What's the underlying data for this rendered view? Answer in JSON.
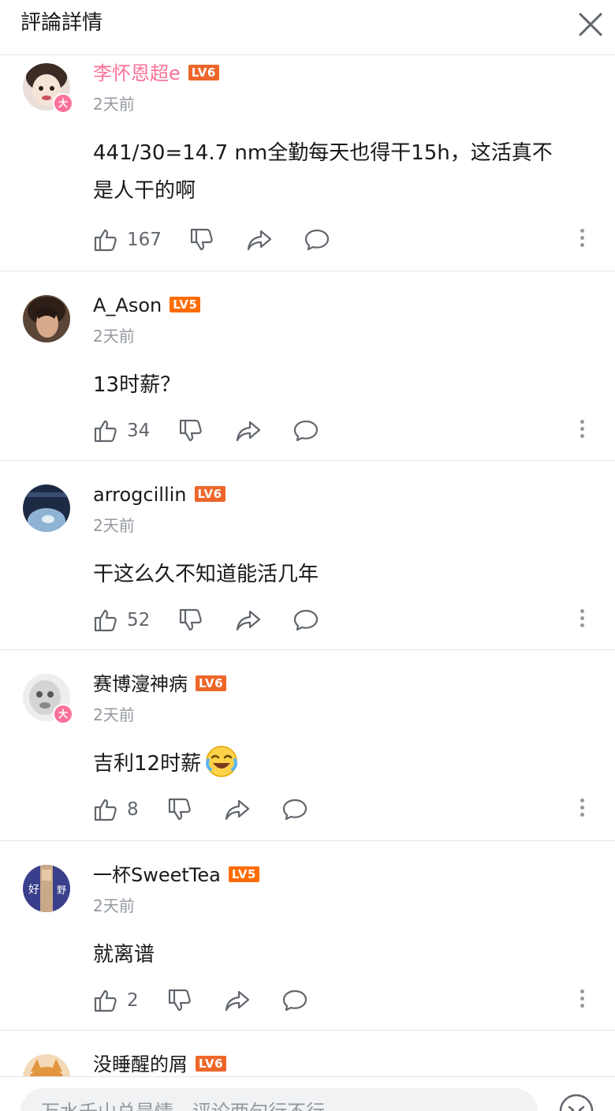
{
  "header": {
    "title": "評論詳情"
  },
  "colors": {
    "vip_name": "#fb7299",
    "level_badge": "#ee672a",
    "muted_text": "#9499a0",
    "divider": "#e3e5e7"
  },
  "icons": {
    "close": "close-icon",
    "like": "thumbs-up-icon",
    "dislike": "thumbs-down-icon",
    "share": "share-icon",
    "reply": "reply-bubble-icon",
    "more": "more-vertical-icon",
    "emoji": "emoji-icon"
  },
  "comments": [
    {
      "user": "李怀恩超e",
      "level": "LV6",
      "vip_badge": "大",
      "time": "2天前",
      "lines": [
        "441/30=14.7 nm全勤每天也得干15h，这活真不",
        "是人干的啊"
      ],
      "likes": "167"
    },
    {
      "user": "A_Ason",
      "level": "LV5",
      "time": "2天前",
      "lines": [
        "13时薪？"
      ],
      "likes": "34"
    },
    {
      "user": "arrogcillin",
      "level": "LV6",
      "time": "2天前",
      "lines": [
        "干这么久不知道能活几年"
      ],
      "likes": "52"
    },
    {
      "user": "赛博濅神病",
      "level": "LV6",
      "vip_badge": "大",
      "time": "2天前",
      "lines": [
        "吉利12时薪"
      ],
      "likes": "8"
    },
    {
      "user": "一杯SweetTea",
      "level": "LV5",
      "avatar_text": [
        "好",
        "野"
      ],
      "time": "2天前",
      "lines": [
        "就离谱"
      ],
      "likes": "2"
    },
    {
      "user": "没睡醒的屑",
      "level": "LV6"
    }
  ],
  "reply": {
    "placeholder": "万水千山总是情，评论两句行不行"
  }
}
